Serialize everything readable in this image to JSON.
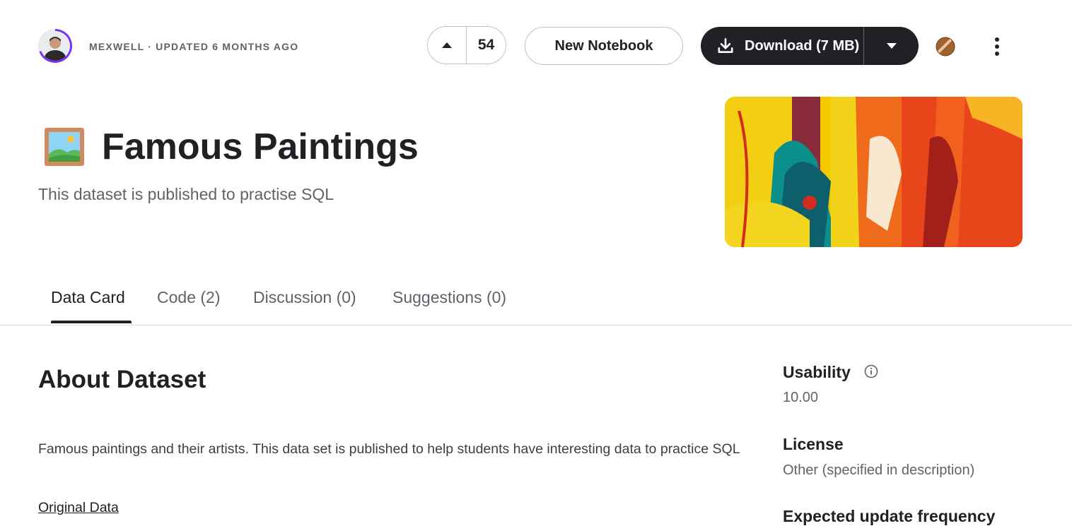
{
  "header": {
    "owner_meta": "MEXWELL · UPDATED 6 MONTHS AGO",
    "vote_count": "54",
    "new_notebook_label": "New Notebook",
    "download_label": "Download (7 MB)"
  },
  "dataset": {
    "title": "Famous Paintings",
    "subtitle": "This dataset is published to practise SQL"
  },
  "tabs": [
    {
      "label": "Data Card",
      "active": true
    },
    {
      "label": "Code (2)",
      "active": false
    },
    {
      "label": "Discussion (0)",
      "active": false
    },
    {
      "label": "Suggestions (0)",
      "active": false
    }
  ],
  "about": {
    "heading": "About Dataset",
    "description": "Famous paintings and their artists. This data set is published to help students have interesting data to practice SQL",
    "link_label": "Original Data"
  },
  "sidebar": {
    "usability_label": "Usability",
    "usability_value": "10.00",
    "license_label": "License",
    "license_value": "Other (specified in description)",
    "update_label": "Expected update frequency"
  },
  "colors": {
    "primary_dark": "#202124",
    "secondary_text": "#5f6368",
    "avatar_ring": "#7b2ff7"
  },
  "icons": [
    "user-avatar",
    "arrow-up-icon",
    "download-icon",
    "chevron-down-icon",
    "more-vert-icon",
    "framed-picture-icon",
    "info-icon"
  ]
}
